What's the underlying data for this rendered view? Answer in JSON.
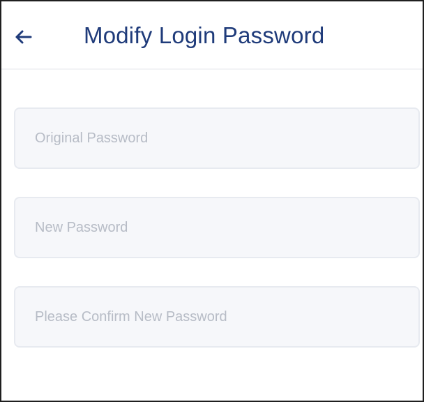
{
  "header": {
    "title": "Modify Login Password",
    "back_icon": "back-arrow-icon"
  },
  "form": {
    "fields": [
      {
        "value": "",
        "placeholder": "Original Password"
      },
      {
        "value": "",
        "placeholder": "New Password"
      },
      {
        "value": "",
        "placeholder": "Please Confirm New Password"
      }
    ]
  },
  "colors": {
    "title": "#1f3b7a",
    "field_bg": "#f6f7fa",
    "field_border": "#e7eaf0",
    "placeholder": "#b7bcc6"
  }
}
